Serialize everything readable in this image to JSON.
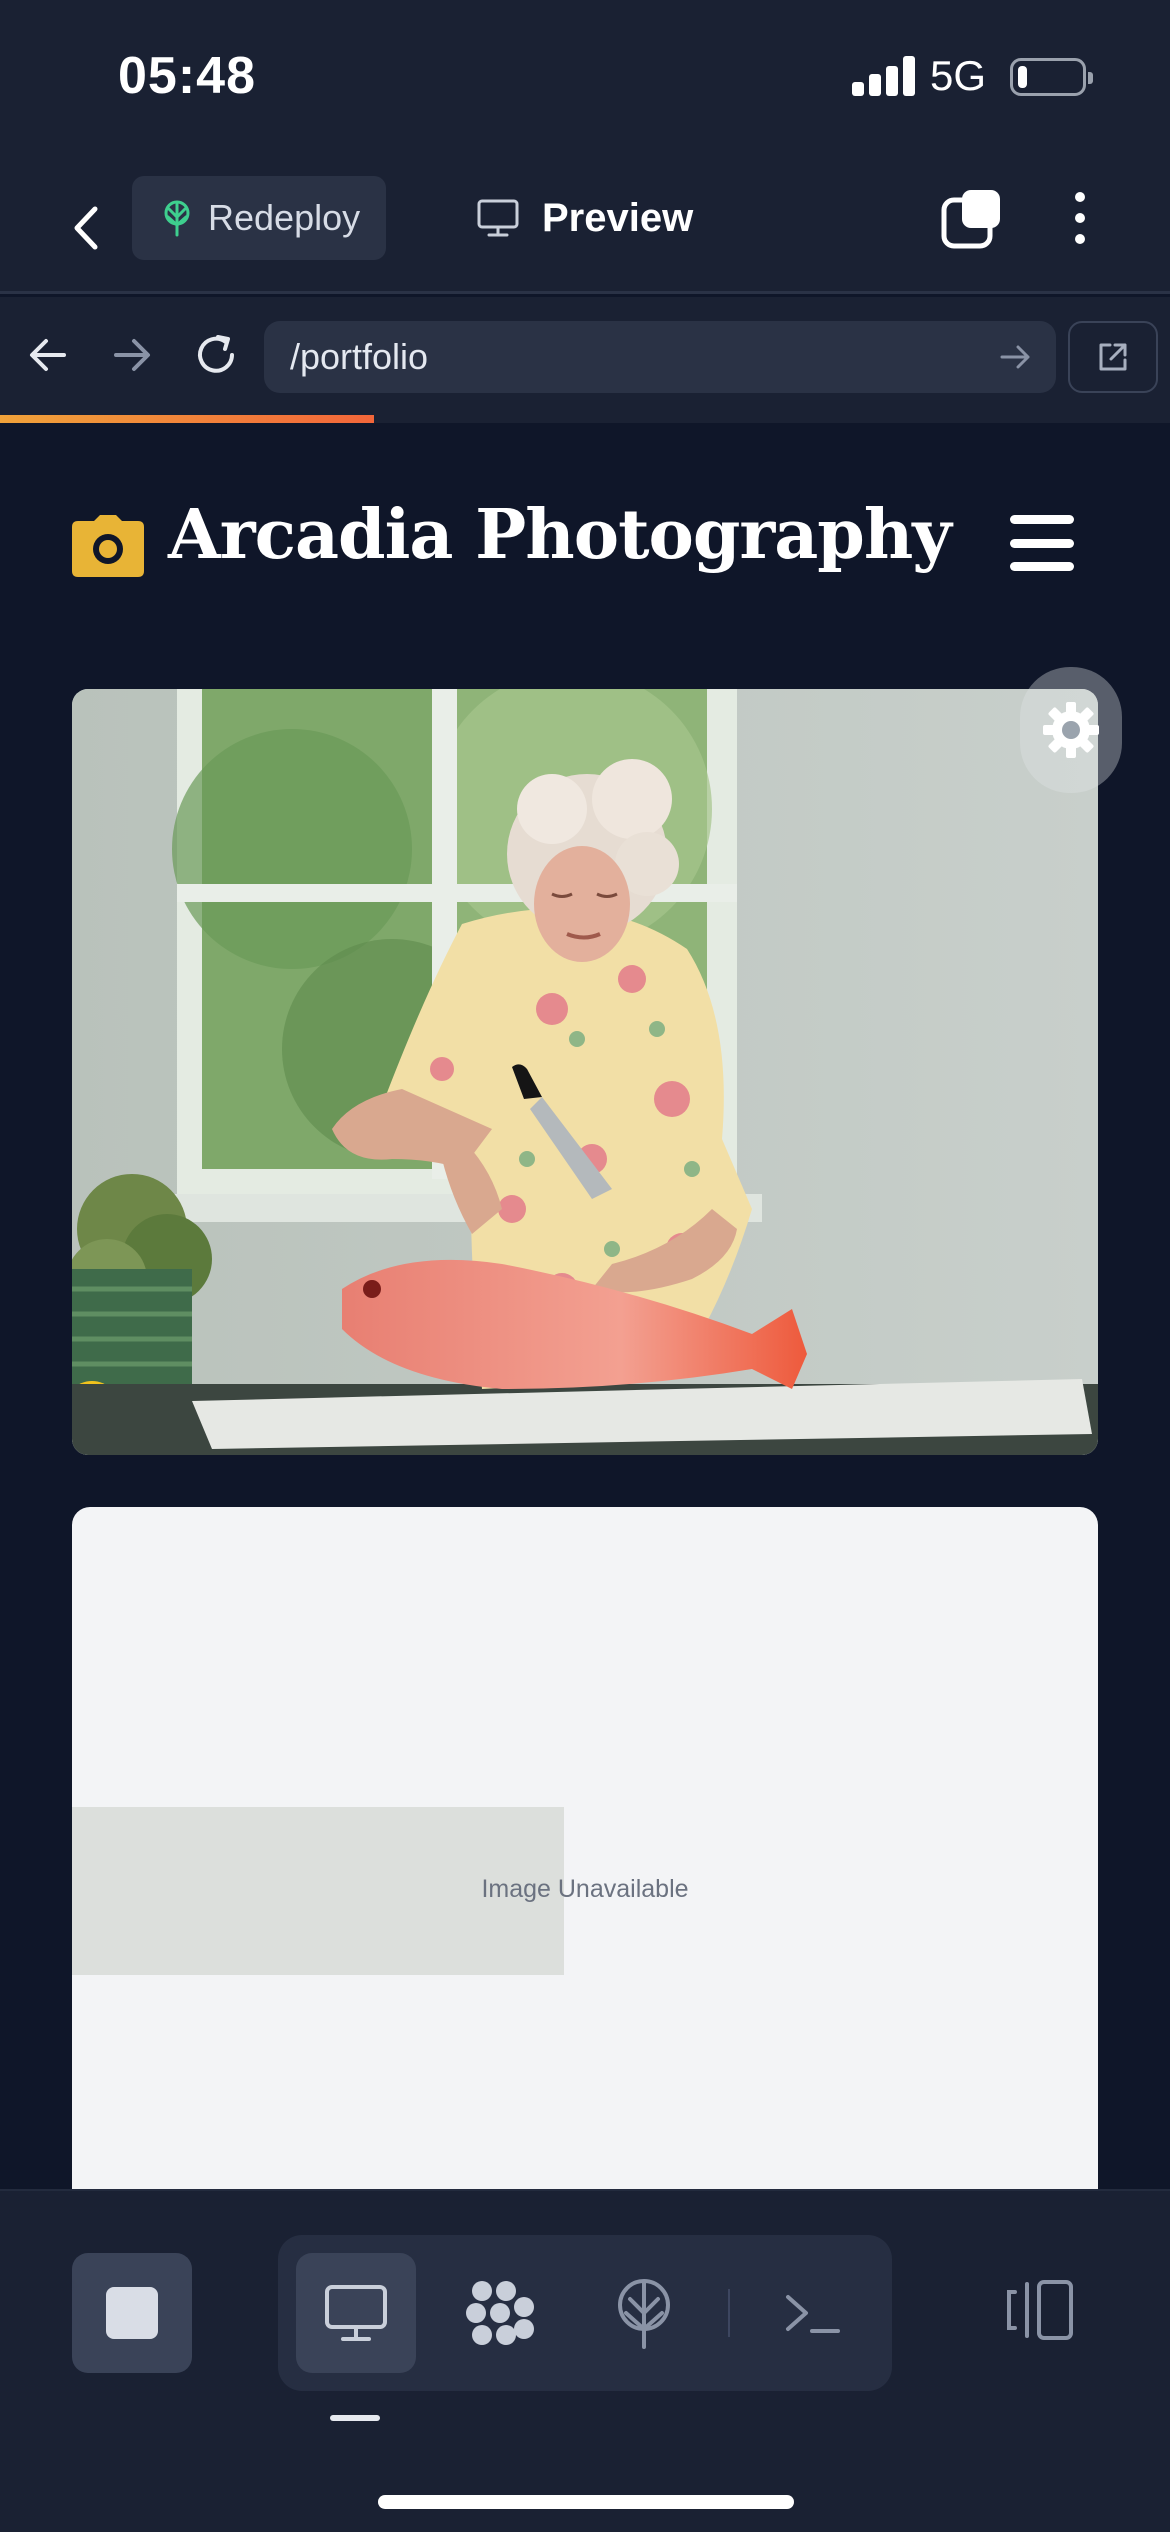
{
  "status_bar": {
    "time": "05:48",
    "network": "5G",
    "battery_level": 0.15
  },
  "toolbar": {
    "back_icon": "chevron-left-icon",
    "redeploy_label": "Redeploy",
    "redeploy_icon": "deploy-tree-icon",
    "preview_label": "Preview",
    "preview_icon": "monitor-icon",
    "tabs_icon": "tabs-icon",
    "more_icon": "more-vertical-icon"
  },
  "browser": {
    "url": "/portfolio",
    "load_progress": 0.32,
    "progress_colors": [
      "#f0a23a",
      "#f2663a"
    ]
  },
  "site": {
    "title": "Arcadia Photography",
    "logo_color": "#e8b436",
    "photo_alt": "Elderly woman in a floral blouse slicing a red snapper on a kitchen counter",
    "broken_image_text": "Image Unavailable"
  },
  "dock": {
    "stop_icon": "stop-icon",
    "modes": [
      "monitor-icon",
      "nodes-icon",
      "deploy-icon",
      "terminal-icon"
    ],
    "active_mode": "monitor-icon",
    "layout_icon": "split-layout-icon"
  },
  "colors": {
    "background": "#0f1629",
    "chrome": "#1a2133",
    "accent_green": "#3ecf8e"
  }
}
